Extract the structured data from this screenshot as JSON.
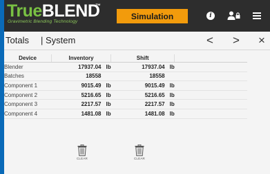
{
  "header": {
    "logo_text_true": "True",
    "logo_text_blend": "BLEND",
    "logo_trademark": "™",
    "logo_subtitle": "Gravimetric Blending Technology",
    "simulation_label": "Simulation",
    "info_glyph": "i"
  },
  "titlebar": {
    "section": "Totals",
    "view": "| System",
    "prev": "<",
    "next": ">",
    "close": "×"
  },
  "table": {
    "headers": [
      "Device",
      "Inventory",
      "Shift"
    ],
    "rows": [
      {
        "device": "Blender",
        "inventory": "17937.04",
        "inventory_unit": "lb",
        "shift": "17937.04",
        "shift_unit": "lb"
      },
      {
        "device": "Batches",
        "inventory": "18558",
        "inventory_unit": "",
        "shift": "18558",
        "shift_unit": ""
      },
      {
        "device": "Component 1",
        "inventory": "9015.49",
        "inventory_unit": "lb",
        "shift": "9015.49",
        "shift_unit": "lb"
      },
      {
        "device": "Component 2",
        "inventory": "5216.65",
        "inventory_unit": "lb",
        "shift": "5216.65",
        "shift_unit": "lb"
      },
      {
        "device": "Component 3",
        "inventory": "2217.57",
        "inventory_unit": "lb",
        "shift": "2217.57",
        "shift_unit": "lb"
      },
      {
        "device": "Component 4",
        "inventory": "1481.08",
        "inventory_unit": "lb",
        "shift": "1481.08",
        "shift_unit": "lb"
      }
    ]
  },
  "actions": {
    "clear_inventory_label": "CLEAR",
    "clear_shift_label": "CLEAR"
  },
  "colors": {
    "accent_blue": "#0a6ab8",
    "header_bg": "#2d2d2d",
    "logo_green": "#79c143",
    "simulation_orange": "#f29b0c"
  },
  "icons": [
    "info-icon",
    "user-lock-icon",
    "hamburger-menu-icon",
    "trash-icon"
  ]
}
